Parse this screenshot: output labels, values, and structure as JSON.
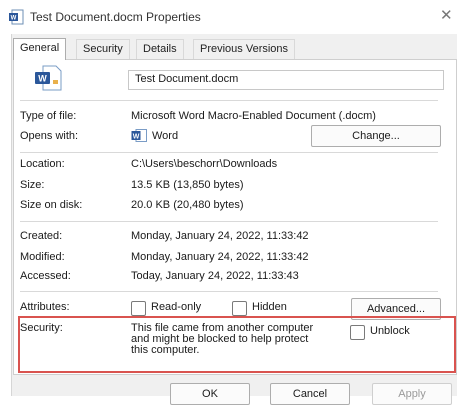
{
  "window": {
    "title": "Test Document.docm Properties",
    "close_glyph": "✕"
  },
  "tabs": [
    {
      "label": "General",
      "active": true
    },
    {
      "label": "Security",
      "active": false
    },
    {
      "label": "Details",
      "active": false
    },
    {
      "label": "Previous Versions",
      "active": false
    }
  ],
  "file": {
    "name": "Test Document.docm"
  },
  "properties": {
    "type_label": "Type of file:",
    "type_value": "Microsoft Word Macro-Enabled Document (.docm)",
    "opens_label": "Opens with:",
    "opens_value": "Word",
    "change_button": "Change...",
    "location_label": "Location:",
    "location_value": "C:\\Users\\beschorr\\Downloads",
    "size_label": "Size:",
    "size_value": "13.5 KB (13,850 bytes)",
    "size_disk_label": "Size on disk:",
    "size_disk_value": "20.0 KB (20,480 bytes)",
    "created_label": "Created:",
    "created_value": "Monday, January 24, 2022, 11:33:42",
    "modified_label": "Modified:",
    "modified_value": "Monday, January 24, 2022, 11:33:42",
    "accessed_label": "Accessed:",
    "accessed_value": "Today, January 24, 2022, 11:33:43",
    "attributes_label": "Attributes:",
    "readonly_label": "Read-only",
    "hidden_label": "Hidden",
    "advanced_button": "Advanced...",
    "security_label": "Security:",
    "security_line1": "This file came from another computer",
    "security_line2": "and might be blocked to help protect",
    "security_line3": "this computer.",
    "unblock_label": "Unblock"
  },
  "footer": {
    "ok": "OK",
    "cancel": "Cancel",
    "apply": "Apply"
  },
  "colors": {
    "highlight": "#d9534f",
    "word_blue": "#2b579a"
  }
}
